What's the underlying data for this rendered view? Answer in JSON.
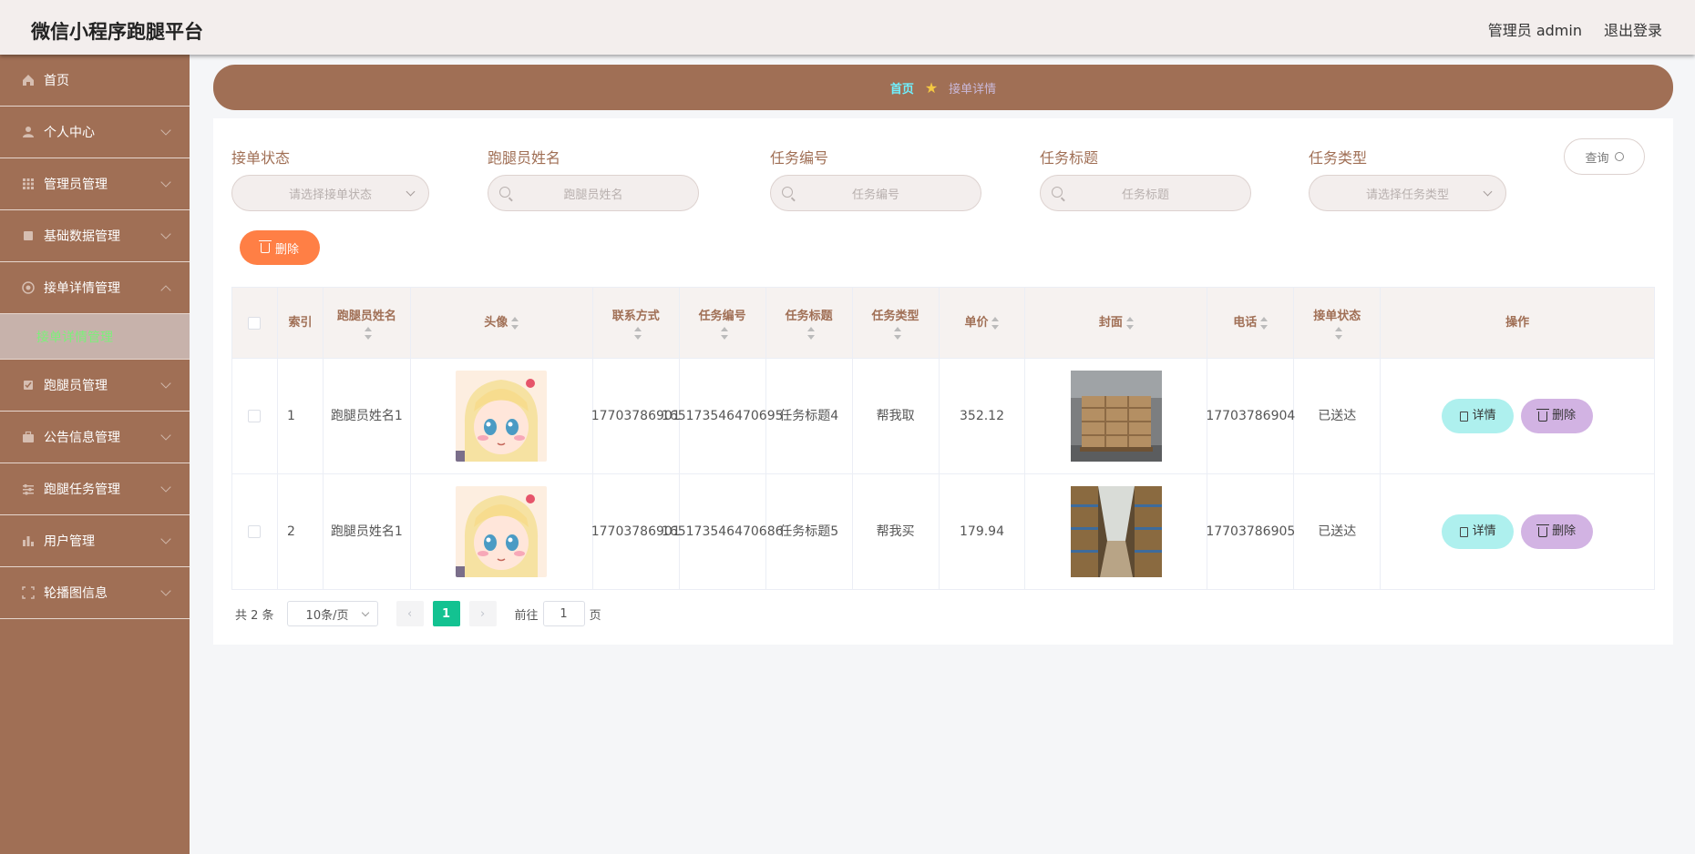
{
  "app": {
    "title": "微信小程序跑腿平台",
    "user": "管理员 admin",
    "logout": "退出登录"
  },
  "sidebar": {
    "items": [
      {
        "label": "首页",
        "icon": "home-icon"
      },
      {
        "label": "个人中心",
        "icon": "user-icon"
      },
      {
        "label": "管理员管理",
        "icon": "grid-icon"
      },
      {
        "label": "基础数据管理",
        "icon": "database-icon"
      },
      {
        "label": "接单详情管理",
        "icon": "target-icon"
      },
      {
        "label": "跑腿员管理",
        "icon": "runner-icon"
      },
      {
        "label": "公告信息管理",
        "icon": "briefcase-icon"
      },
      {
        "label": "跑腿任务管理",
        "icon": "sliders-icon"
      },
      {
        "label": "用户管理",
        "icon": "chart-icon"
      },
      {
        "label": "轮播图信息",
        "icon": "carousel-icon"
      }
    ],
    "active_sub": "接单详情管理"
  },
  "breadcrumb": {
    "home": "首页",
    "current": "接单详情"
  },
  "filters": {
    "status": {
      "label": "接单状态",
      "placeholder": "请选择接单状态"
    },
    "runner_name": {
      "label": "跑腿员姓名",
      "placeholder": "跑腿员姓名"
    },
    "task_no": {
      "label": "任务编号",
      "placeholder": "任务编号"
    },
    "task_title": {
      "label": "任务标题",
      "placeholder": "任务标题"
    },
    "task_type": {
      "label": "任务类型",
      "placeholder": "请选择任务类型"
    },
    "query": "查询"
  },
  "actions": {
    "delete": "删除"
  },
  "table": {
    "headers": [
      "索引",
      "跑腿员姓名",
      "头像",
      "联系方式",
      "任务编号",
      "任务标题",
      "任务类型",
      "单价",
      "封面",
      "电话",
      "接单状态",
      "操作"
    ],
    "rows": [
      {
        "index": "1",
        "runner_name": "跑腿员姓名1",
        "contact": "17703786901",
        "task_no": "165173546470695",
        "task_title": "任务标题4",
        "task_type": "帮我取",
        "price": "352.12",
        "phone": "17703786904",
        "status": "已送达"
      },
      {
        "index": "2",
        "runner_name": "跑腿员姓名1",
        "contact": "17703786901",
        "task_no": "165173546470686",
        "task_title": "任务标题5",
        "task_type": "帮我买",
        "price": "179.94",
        "phone": "17703786905",
        "status": "已送达"
      }
    ],
    "detail_btn": "详情",
    "delete_btn": "删除"
  },
  "pager": {
    "total": "共 2 条",
    "page_size": "10条/页",
    "current": "1",
    "goto_prefix": "前往",
    "goto_value": "1",
    "goto_suffix": "页"
  },
  "colors": {
    "brand": "#a06f55",
    "accent_delete": "#ff7f45",
    "page_active": "#13c291",
    "detail": "#aef0ee",
    "row_delete": "#d2b3e3"
  }
}
